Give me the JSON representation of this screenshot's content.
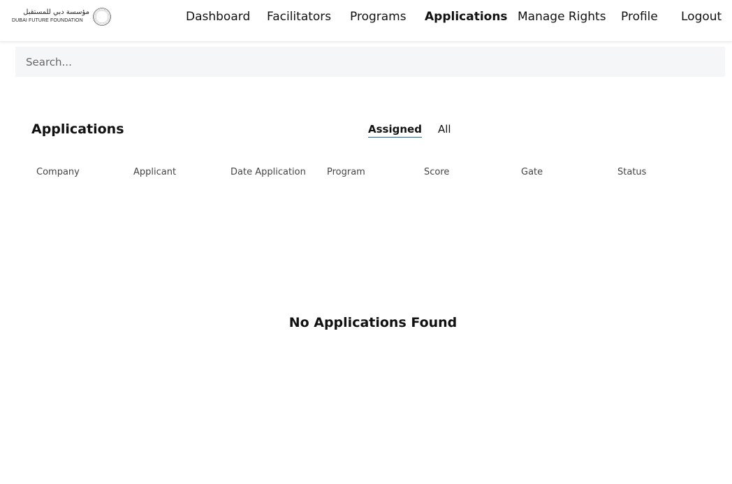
{
  "header": {
    "logo": {
      "text_ar": "مؤسسة دبي للمستقبل",
      "text_en": "DUBAI FUTURE FOUNDATION"
    },
    "nav": [
      {
        "label": "Dashboard",
        "active": false
      },
      {
        "label": "Facilitators",
        "active": false
      },
      {
        "label": "Programs",
        "active": false
      },
      {
        "label": "Applications",
        "active": true
      },
      {
        "label": "Manage Rights",
        "active": false
      },
      {
        "label": "Profile",
        "active": false
      },
      {
        "label": "Logout",
        "active": false
      }
    ]
  },
  "search": {
    "placeholder": "Search...",
    "value": ""
  },
  "main": {
    "title": "Applications",
    "tabs": [
      {
        "label": "Assigned",
        "active": true
      },
      {
        "label": "All",
        "active": false
      }
    ],
    "columns": [
      "Company",
      "Applicant",
      "Date Application",
      "Program",
      "Score",
      "Gate",
      "Status"
    ],
    "rows": [],
    "empty_message": "No Applications Found"
  },
  "colors": {
    "background": "#ffffff",
    "search_bg": "#f5f6f8",
    "tab_underline": "#1a6aa8",
    "text": "#111111",
    "muted_text": "#444444"
  }
}
